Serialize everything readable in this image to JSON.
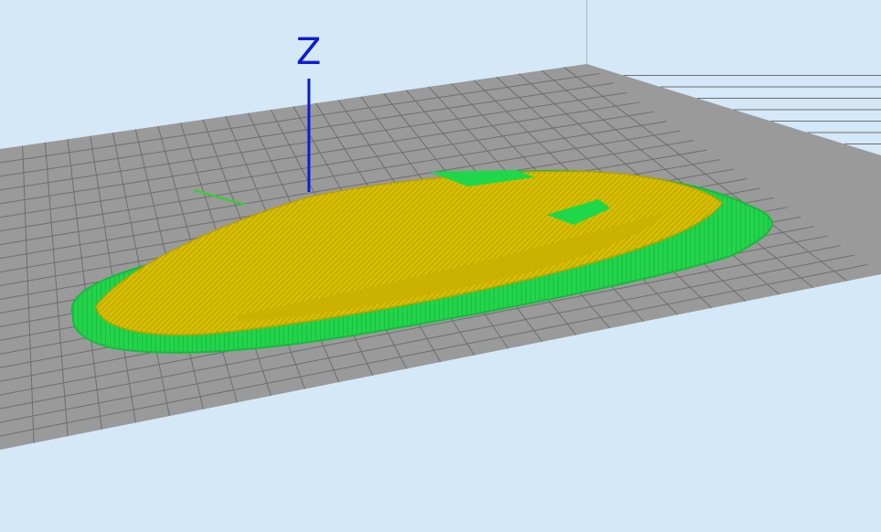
{
  "viewport": {
    "axis_label_z": "Z",
    "background_color": "#d4e8f8",
    "bed_color": "#9a9a9a",
    "bed_grid_color": "#6e6e6e",
    "axis_z_color": "#0d1ad6",
    "axis_y_color": "#2bd42b",
    "model_color": "#d6c000",
    "support_color": "#1ed84a",
    "icon": "3d-viewport"
  }
}
